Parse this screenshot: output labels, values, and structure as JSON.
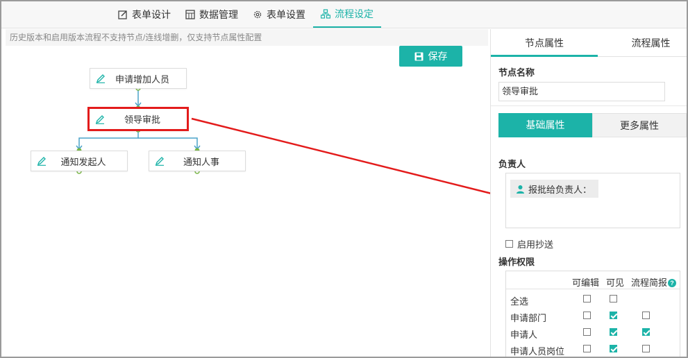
{
  "tabs": [
    {
      "label": "表单设计",
      "icon": "edit-square-icon"
    },
    {
      "label": "数据管理",
      "icon": "data-grid-icon"
    },
    {
      "label": "表单设置",
      "icon": "gear-icon"
    },
    {
      "label": "流程设定",
      "icon": "flow-icon",
      "active": true
    }
  ],
  "notice": "历史版本和启用版本流程不支持节点/连线增删，仅支持节点属性配置",
  "save_label": "保存",
  "nodes": {
    "n1": "申请增加人员",
    "n2": "领导审批",
    "n3": "通知发起人",
    "n4": "通知人事"
  },
  "panel": {
    "tab_node": "节点属性",
    "tab_flow": "流程属性",
    "node_name_label": "节点名称",
    "node_name_value": "领导审批",
    "seg_basic": "基础属性",
    "seg_more": "更多属性",
    "owner_label": "负责人",
    "owner_chip": "报批给负责人：",
    "cc_label": "启用抄送",
    "perm_label": "操作权限",
    "perm_headers": {
      "edit": "可编辑",
      "visible": "可见",
      "brief": "流程简报"
    },
    "perm_rows": [
      {
        "name": "全选",
        "edit": false,
        "visible": false,
        "brief": null
      },
      {
        "name": "申请部门",
        "edit": false,
        "visible": true,
        "brief": false
      },
      {
        "name": "申请人",
        "edit": false,
        "visible": true,
        "brief": true
      },
      {
        "name": "申请人员岗位",
        "edit": false,
        "visible": true,
        "brief": false
      }
    ]
  },
  "colors": {
    "accent": "#1cb3a8",
    "highlight": "#e31b1b",
    "connector": "#4aa3c9",
    "port": "#7ab648"
  }
}
